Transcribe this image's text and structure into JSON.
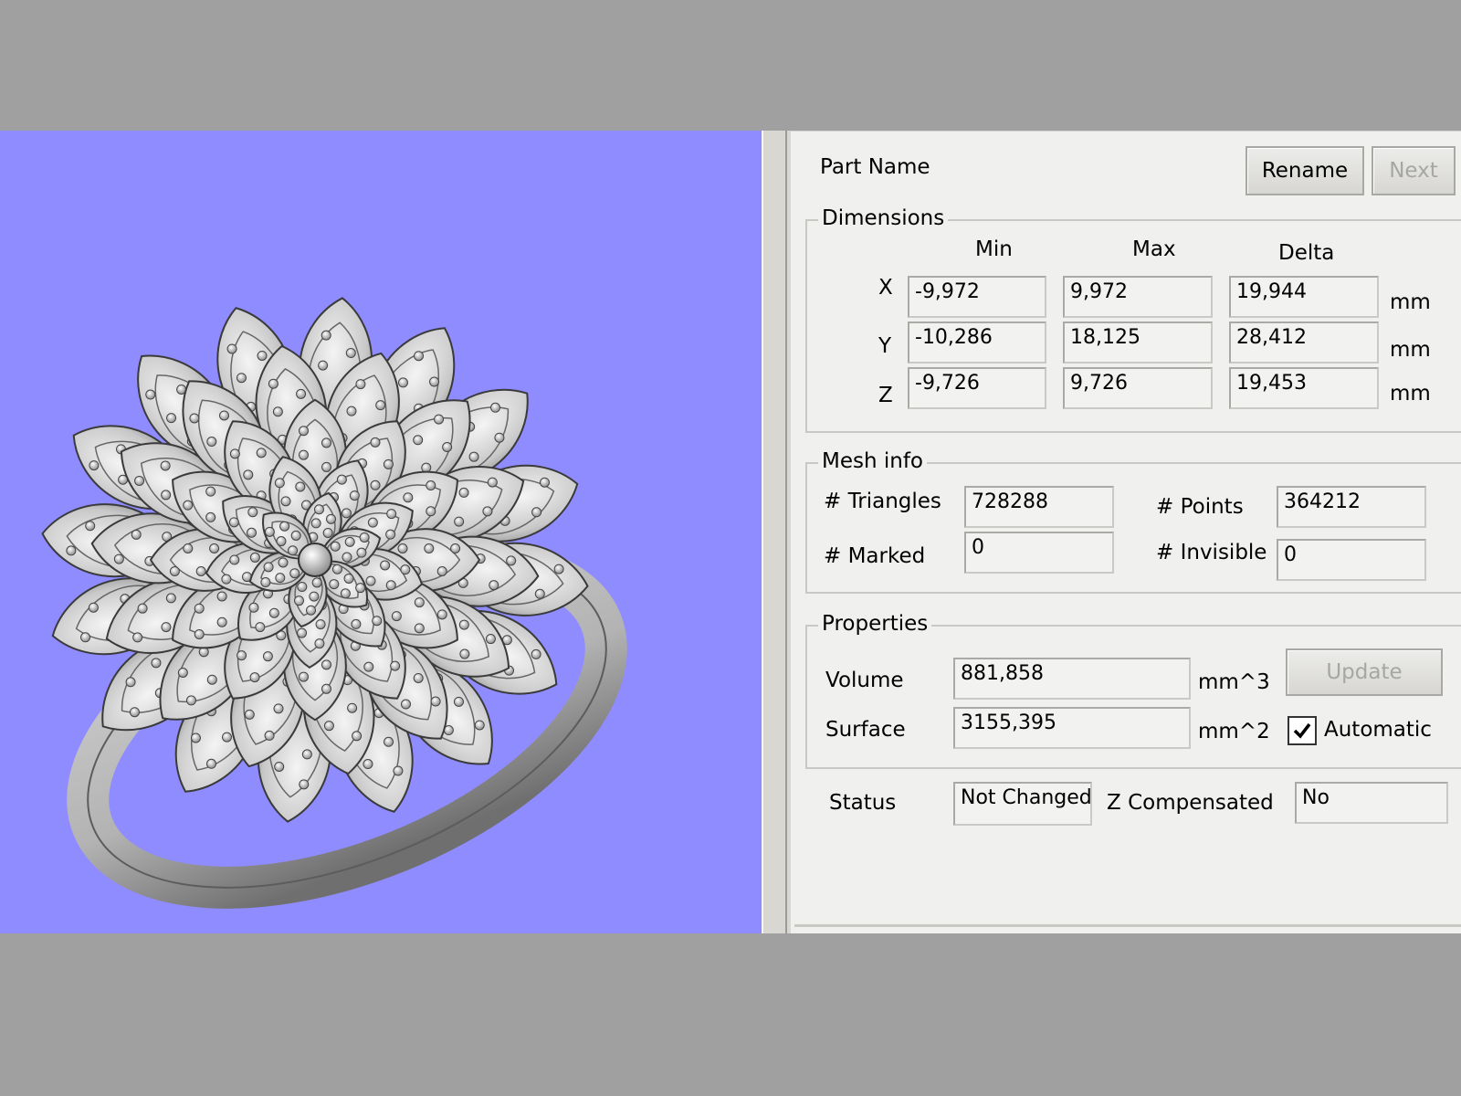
{
  "part": {
    "label": "Part Name",
    "rename_label": "Rename",
    "next_label": "Next"
  },
  "dimensions": {
    "legend": "Dimensions",
    "headers": {
      "min": "Min",
      "max": "Max",
      "delta": "Delta"
    },
    "unit": "mm",
    "rows": [
      {
        "axis": "X",
        "min": "-9,972",
        "max": "9,972",
        "delta": "19,944"
      },
      {
        "axis": "Y",
        "min": "-10,286",
        "max": "18,125",
        "delta": "28,412"
      },
      {
        "axis": "Z",
        "min": "-9,726",
        "max": "9,726",
        "delta": "19,453"
      }
    ]
  },
  "mesh": {
    "legend": "Mesh info",
    "triangles_label": "# Triangles",
    "triangles": "728288",
    "points_label": "# Points",
    "points": "364212",
    "marked_label": "# Marked",
    "marked": "0",
    "invisible_label": "# Invisible",
    "invisible": "0"
  },
  "properties": {
    "legend": "Properties",
    "volume_label": "Volume",
    "volume": "881,858",
    "volume_unit": "mm^3",
    "surface_label": "Surface",
    "surface": "3155,395",
    "surface_unit": "mm^2",
    "update_label": "Update",
    "automatic_label": "Automatic",
    "automatic_checked": true
  },
  "status": {
    "label": "Status",
    "value": "Not Changed",
    "z_comp_label": "Z Compensated",
    "z_comp_value": "No"
  },
  "colors": {
    "viewport_bg": "#8f8cff",
    "model": "#cfcfcf",
    "panel_bg": "#f0f0ee"
  }
}
